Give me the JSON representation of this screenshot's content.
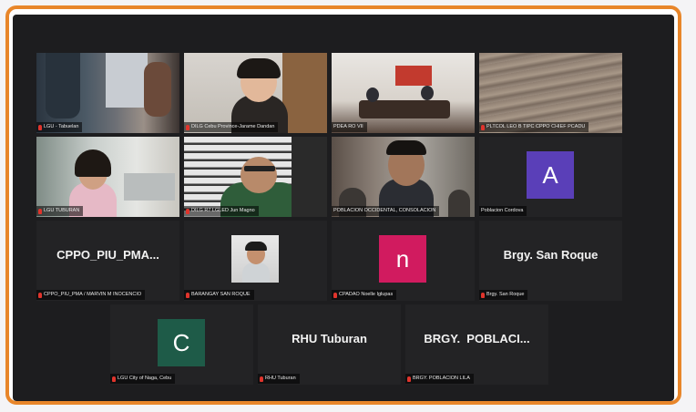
{
  "colors": {
    "frame_border": "#e8862a",
    "screen_bg": "#1d1d1f",
    "active_speaker_outline": "#b6d86a",
    "mic_muted": "#e0342c",
    "avatar_a": "#5a3fb8",
    "avatar_n": "#d11b5f",
    "avatar_c": "#1e5b48"
  },
  "participants": [
    {
      "label": "LGU - Tabuelan",
      "type": "video",
      "mic": "muted"
    },
    {
      "label": "DILG Cebu Province-Jarame Dandan",
      "type": "video",
      "mic": "muted"
    },
    {
      "label": "PDEA RO VII",
      "type": "video",
      "mic": "unmuted"
    },
    {
      "label": "PLTCOL LEO B TIPC CPPO CHIEF PCADU",
      "type": "video",
      "mic": "muted"
    },
    {
      "label": "LGU TUBURAN",
      "type": "video",
      "mic": "muted"
    },
    {
      "label": "DILG R7 LGLED Jun Magno",
      "type": "video",
      "mic": "muted"
    },
    {
      "label": "POBLACION OCCIDENTAL, CONSOLACION",
      "type": "video",
      "mic": "unmuted",
      "active": true
    },
    {
      "label": "Poblacion Cordova",
      "type": "avatar-letter",
      "letter": "A",
      "icon": "avatar-letter-a",
      "mic": "unmuted"
    },
    {
      "label": "CPPO_PIU_PMA / MARVIN M INOCENCIO",
      "type": "name",
      "display": "CPPO_PIU_PMA...",
      "mic": "muted"
    },
    {
      "label": "BARANGAY SAN ROQUE",
      "type": "avatar-photo",
      "icon": "profile-photo",
      "mic": "muted"
    },
    {
      "label": "CPADAO Noelle Iglupas",
      "type": "avatar-letter",
      "letter": "n",
      "icon": "avatar-letter-n",
      "mic": "muted"
    },
    {
      "label": "Brgy. San Roque",
      "type": "name",
      "display": "Brgy. San Roque",
      "mic": "muted"
    },
    {
      "label": "LGU City of Naga, Cebu",
      "type": "avatar-letter",
      "letter": "C",
      "icon": "avatar-letter-c",
      "mic": "muted"
    },
    {
      "label": "RHU Tuburan",
      "type": "name",
      "display": "RHU Tuburan",
      "mic": "muted"
    },
    {
      "label": "BRGY. POBLACION LILA",
      "type": "name",
      "display": "BRGY.  POBLACI...",
      "mic": "muted"
    }
  ]
}
